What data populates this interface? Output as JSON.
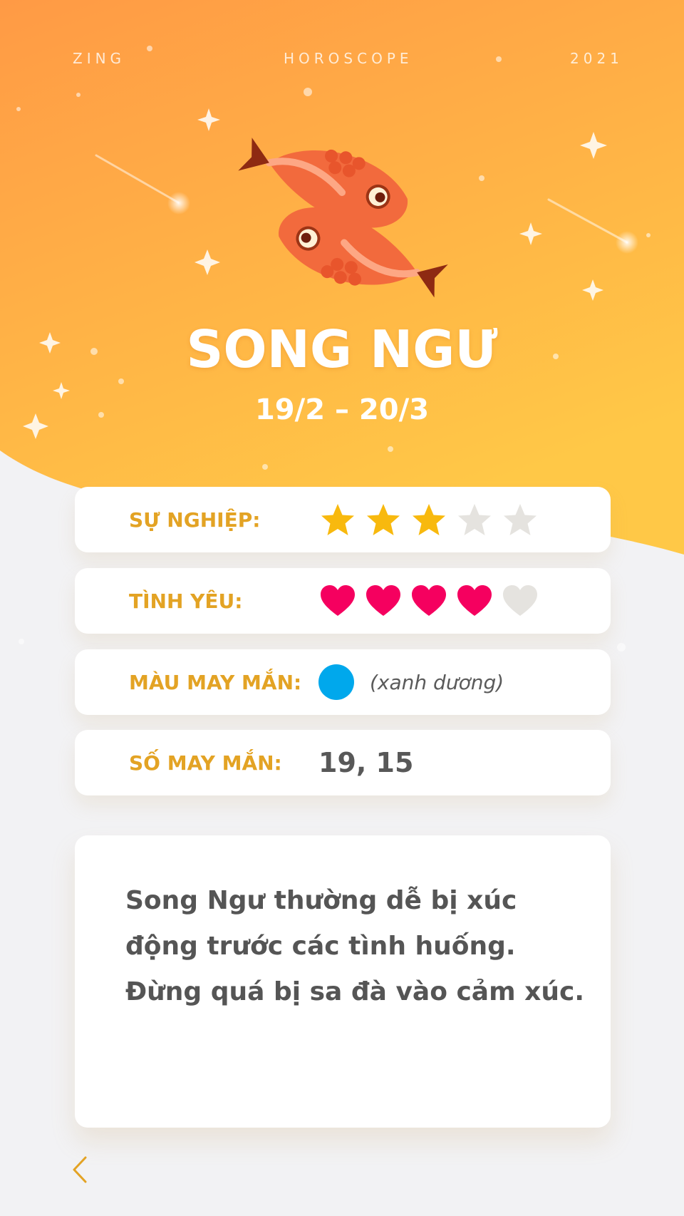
{
  "header": {
    "brand": "ZING",
    "section": "HOROSCOPE",
    "year": "2021"
  },
  "sign": {
    "name": "SONG NGƯ",
    "dates": "19/2 – 20/3",
    "icon": "pisces-fish-icon"
  },
  "rows": {
    "career": {
      "label": "SỰ NGHIỆP:",
      "rating": 3,
      "max": 5,
      "icon": "star-icon"
    },
    "love": {
      "label": "TÌNH YÊU:",
      "rating": 4,
      "max": 5,
      "icon": "heart-icon"
    },
    "lucky_color": {
      "label": "MÀU MAY MẮN:",
      "color": "#00A8EC",
      "name": "(xanh dương)"
    },
    "lucky_number": {
      "label": "SỐ MAY MẮN:",
      "value": "19, 15"
    }
  },
  "description": "Song Ngư thường dễ bị xúc động trước các tình huống. Đừng quá bị sa đà vào cảm xúc.",
  "nav": {
    "back_icon": "chevron-left-icon"
  },
  "colors": {
    "accent": "#E3A324",
    "star_on": "#F8B90E",
    "star_off": "#E5E3DF",
    "heart_on": "#F5005F",
    "heart_off": "#E5E3DF",
    "gradient_top": "#FF9A45",
    "gradient_bottom": "#FFC847"
  }
}
